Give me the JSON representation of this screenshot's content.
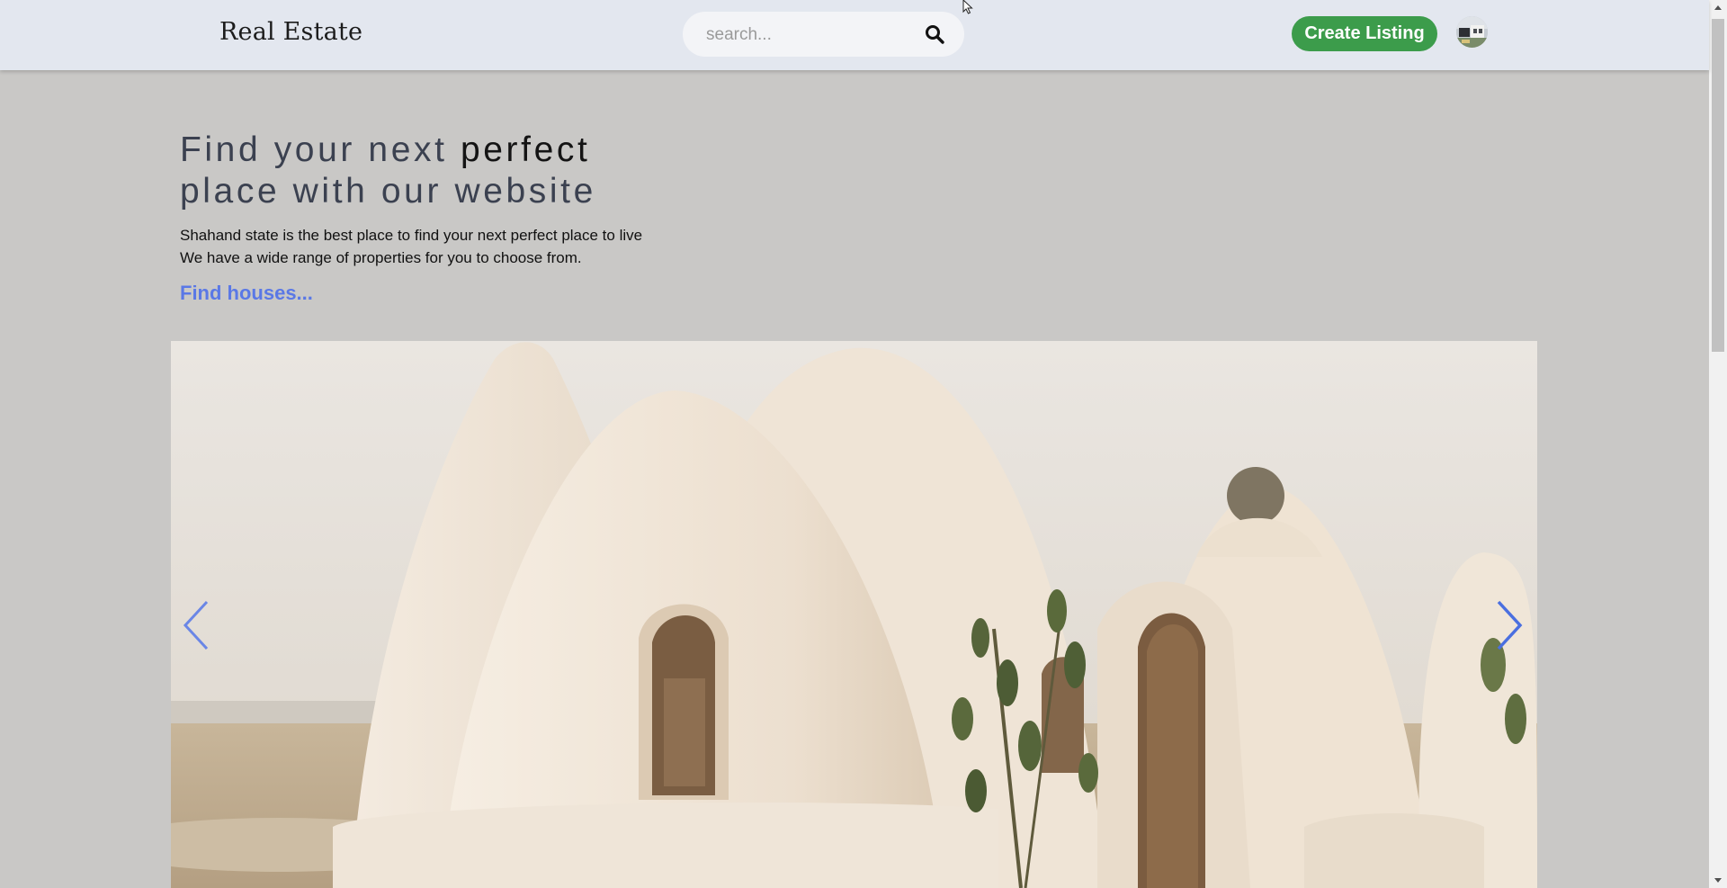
{
  "header": {
    "brand": "Real Estate",
    "search_placeholder": "search...",
    "create_listing_label": "Create Listing"
  },
  "hero": {
    "title_part1": "Find your next ",
    "title_emphasis": "perfect",
    "title_part2": "place with our website",
    "description_line1": "Shahand state is the best place to find your next perfect place to live",
    "description_line2": "We have a wide range of properties for you to choose from.",
    "cta_link": "Find houses..."
  },
  "carousel": {
    "image_subject": "white dome houses"
  },
  "icons": {
    "search": "search-icon",
    "prev": "chevron-left-icon",
    "next": "chevron-right-icon",
    "avatar": "avatar"
  },
  "colors": {
    "header_bg": "#e3e7ef",
    "page_bg": "#c9c8c6",
    "create_button": "#3c9c4b",
    "link": "#5a78e6",
    "carousel_arrows": "#4a6fe0"
  }
}
